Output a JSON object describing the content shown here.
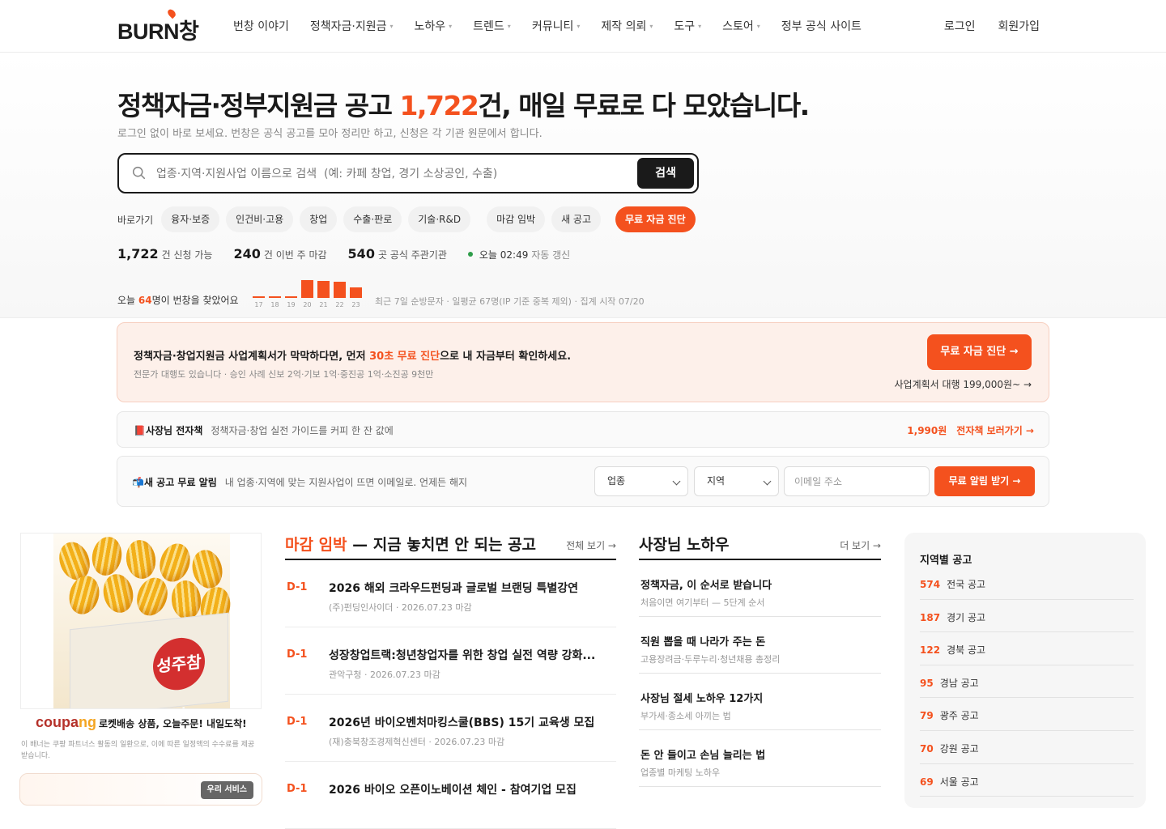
{
  "header": {
    "logo": "BURN창",
    "nav": [
      {
        "label": "번창 이야기",
        "caret": false
      },
      {
        "label": "정책자금·지원금",
        "caret": true
      },
      {
        "label": "노하우",
        "caret": true
      },
      {
        "label": "트렌드",
        "caret": true
      },
      {
        "label": "커뮤니티",
        "caret": true
      },
      {
        "label": "제작 의뢰",
        "caret": true
      },
      {
        "label": "도구",
        "caret": true
      },
      {
        "label": "스토어",
        "caret": true
      },
      {
        "label": "정부 공식 사이트",
        "caret": false
      }
    ],
    "login": "로그인",
    "signup": "회원가입"
  },
  "hero": {
    "title_pre": "정책자금·정부지원금 공고 ",
    "title_count": "1,722",
    "title_post": "건, 매일 무료로 다 모았습니다.",
    "subtitle": "로그인 없이 바로 보세요. 번창은 공식 공고를 모아 정리만 하고, 신청은 각 기관 원문에서 합니다.",
    "search_placeholder": "업종·지역·지원사업 이름으로 검색  (예: 카페 창업, 경기 소상공인, 수출)",
    "search_button": "검색",
    "quick_label": "바로가기",
    "quick_chips": [
      "융자·보증",
      "인건비·고용",
      "창업",
      "수출·판로",
      "기술·R&D"
    ],
    "quick_chips2": [
      "마감 임박",
      "새 공고"
    ],
    "quick_cta": "무료 자금 진단",
    "stats": [
      {
        "num": "1,722",
        "label": "건 신청 가능"
      },
      {
        "num": "240",
        "label": "건 이번 주 마감"
      },
      {
        "num": "540",
        "label": "곳 공식 주관기관"
      }
    ],
    "update_time": "오늘 02:49",
    "update_label": "자동 갱신",
    "visit_pre": "오늘 ",
    "visit_num": "64",
    "visit_post": "명이 번창을 찾았어요",
    "visit_chart": {
      "days": [
        "17",
        "18",
        "19",
        "20",
        "21",
        "22",
        "23"
      ],
      "values": [
        2,
        2,
        2,
        28,
        27,
        25,
        17
      ]
    },
    "visit_note": "최근 7일 순방문자 · 일평균 67명(IP 기준 중복 제외) · 집계 시작 07/20"
  },
  "promo": {
    "text_pre": "정책자금·창업지원금 사업계획서가 막막하다면, 먼저 ",
    "text_accent": "30초 무료 진단",
    "text_post": "으로 내 자금부터 확인하세요.",
    "sub": "전문가 대행도 있습니다 · 승인 사례 신보 2억·기보 1억·중진공 1억·소진공 9천만",
    "button": "무료 자금 진단 →",
    "link": "사업계획서 대행 199,000원~ →"
  },
  "ebook": {
    "icon": "📕",
    "title": "사장님 전자책",
    "desc": "정책자금·창업 실전 가이드를 커피 한 잔 값에",
    "price": "1,990원",
    "link": "전자책 보러가기 →"
  },
  "alert": {
    "icon": "📬",
    "title": "새 공고 무료 알림",
    "desc": "내 업종·지역에 맞는 지원사업이 뜨면 이메일로. 언제든 해지",
    "industry": "업종",
    "region": "지역",
    "email_placeholder": "이메일 주소",
    "button": "무료 알림 받기 →"
  },
  "ad": {
    "crate_label": "성주참외",
    "brand1": "coupa",
    "brand2": "ng",
    "tagline": "로켓배송 상품, 오늘주문! 내일도착!",
    "disclaimer": "이 배너는 쿠팡 파트너스 활동의 일환으로, 이에 따른 일정액의 수수료를 제공받습니다.",
    "service_pill": "우리 서비스"
  },
  "deadline": {
    "title_accent": "마감 임박",
    "title_rest": " — 지금 놓치면 안 되는 공고",
    "more": "전체 보기 →",
    "items": [
      {
        "dday": "D-1",
        "title": "2026 해외 크라우드펀딩과 글로벌 브랜딩 특별강연",
        "meta": "(주)펀딩인사이더 · 2026.07.23 마감"
      },
      {
        "dday": "D-1",
        "title": "성장창업트랙:청년창업자를 위한 창업 실전 역량 강화...",
        "meta": "관악구청 · 2026.07.23 마감"
      },
      {
        "dday": "D-1",
        "title": "2026년 바이오벤처마킹스쿨(BBS) 15기 교육생 모집",
        "meta": "(재)충북창조경제혁신센터 · 2026.07.23 마감"
      },
      {
        "dday": "D-1",
        "title": "2026 바이오 오픈이노베이션 체인 - 참여기업 모집",
        "meta": ""
      }
    ]
  },
  "knowhow": {
    "title": "사장님 노하우",
    "more": "더 보기 →",
    "items": [
      {
        "title": "정책자금, 이 순서로 받습니다",
        "meta": "처음이면 여기부터 — 5단계 순서"
      },
      {
        "title": "직원 뽑을 때 나라가 주는 돈",
        "meta": "고용장려금·두루누리·청년채용 총정리"
      },
      {
        "title": "사장님 절세 노하우 12가지",
        "meta": "부가세·종소세 아끼는 법"
      },
      {
        "title": "돈 안 들이고 손님 늘리는 법",
        "meta": "업종별 마케팅 노하우"
      }
    ]
  },
  "regions": {
    "title": "지역별 공고",
    "items": [
      {
        "count": "574",
        "label": "전국 공고"
      },
      {
        "count": "187",
        "label": "경기 공고"
      },
      {
        "count": "122",
        "label": "경북 공고"
      },
      {
        "count": "95",
        "label": "경남 공고"
      },
      {
        "count": "79",
        "label": "광주 공고"
      },
      {
        "count": "70",
        "label": "강원 공고"
      },
      {
        "count": "69",
        "label": "서울 공고"
      }
    ]
  },
  "colors": {
    "accent": "#f4511e",
    "dark": "#1a1a1a",
    "up": "#2e9d4a"
  }
}
